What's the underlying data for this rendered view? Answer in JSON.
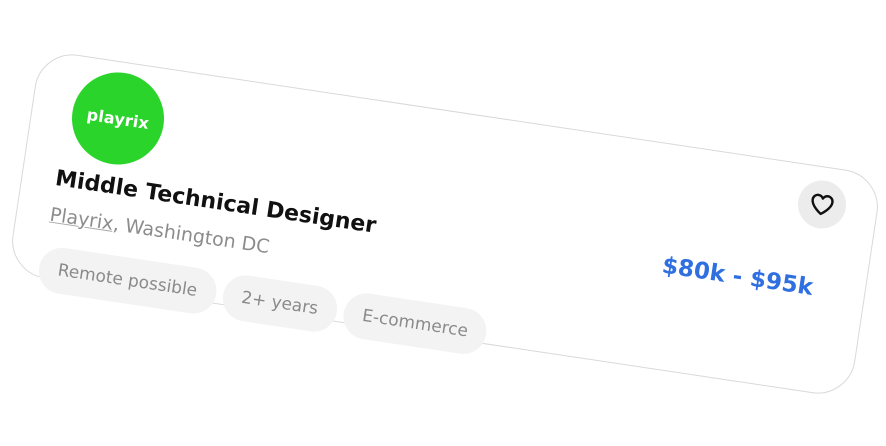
{
  "job_card": {
    "logo_text": "playrix",
    "title": "Middle Technical Designer",
    "company": "Playrix",
    "location_separator": ", ",
    "location": "Washington DC",
    "tags": [
      "Remote possible",
      "2+ years",
      "E-commerce"
    ],
    "salary": "$80k - $95k",
    "favorite_icon": "heart-icon"
  },
  "colors": {
    "logo_bg": "#2bd42b",
    "salary": "#2f6fe0",
    "tag_bg": "#f3f3f3",
    "card_border": "#d9d9d9"
  }
}
